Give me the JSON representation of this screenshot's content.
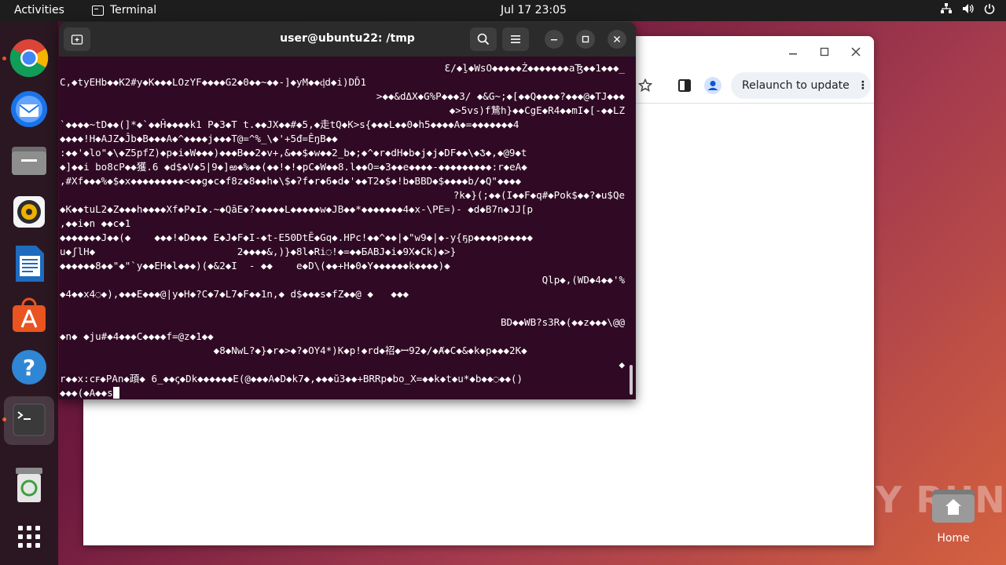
{
  "topbar": {
    "activities": "Activities",
    "app_name": "Terminal",
    "clock": "Jul 17  23:05",
    "tray_icons": [
      "network-icon",
      "volume-icon",
      "power-icon"
    ]
  },
  "dock": {
    "items": [
      "chrome-icon",
      "thunderbird-icon",
      "files-icon",
      "rhythmbox-icon",
      "libreoffice-writer-icon",
      "app-center-icon",
      "help-icon",
      "terminal-icon",
      "trash-icon",
      "show-apps-icon"
    ]
  },
  "browser": {
    "relaunch_label": "Relaunch to update"
  },
  "terminal": {
    "title": "user@ubuntu22: /tmp",
    "lines": [
      {
        "text": "Ɛ/◆ḻ◆WsO◆◆◆◆◆Ż◆◆◆◆◆◆◆",
        "right": "aꜨ◆◆1◆◆◆_"
      },
      {
        "text": "C‚◆tyEHb◆◆K2#y◆K◆◆◆LOzYF◆◆◆◆G2◆0◆◆~◆◆-]◆yM◆◆ᶁd◆i)DĎ1",
        "right": ""
      },
      {
        "text": "",
        "right": ">◆◆&dΔX◆G%P◆◆◆3/ ◆&G~;◆[◆◆Q◆◆◆◆?◆◆◆@◆TJ◆◆◆"
      },
      {
        "text": "",
        "right": "◆>5vs)f鷙h}◆◆CgE◆R4◆◆mI◆[-◆◆LZ"
      },
      {
        "text": "`◆◆◆◆~tD◆◆(]*◆`◆◆Ĥ◆◆◆◆k1 P◆3◆T t.◆◆JX◆◆#◆5,◆走tQ◆K>s{◆◆◆L◆◆0◆h5◆◆◆◆A◆=◆◆◆◆◆◆◆4",
        "right": ""
      },
      {
        "text": "◆◆◆◆!H◆AJZ◆Ĵb◆B◆◆◆A◆^◆◆◆◆j◆◆◆T@=^%_\\◆'+5đ=ÊŋB◆◆",
        "right": ""
      },
      {
        "text": ":◆◆'◆lo\"◆\\◆Z5pfZ)◆p◆i◆W◆◆◆)◆◆◆B◆◆2◆v+,&◆◆$◆w◆◆2_b◆;◆^◆r◆dH◆b◆j◆j◆DF◆◆\\◆Ჯ◆,◆@9◆t",
        "right": ""
      },
      {
        "text": "◆]◆◆i bo8cP◆◆獲.6 ◆d$◆V◆5|9◆]ఱ◆%◆◆(◆◆!◆!◆pC◆W◆◆8.l◆◆O=◆3◆◆e◆◆◆◆-◆◆◆◆◆◆◆◆◆:r◆eA◆",
        "right": ""
      },
      {
        "text": ",#Xf◆◆◆%◆$◆x◆◆◆◆◆◆◆◆◆<◆◆g◆c◆f8z◆8◆◆h◆\\$◆ʔf◆r◆6◆d◆'◆◆T2◆$◆!b◆BBD◆$◆◆◆◆b/◆Q\"◆◆◆◆",
        "right": ""
      },
      {
        "text": "",
        "right": "?k◆}(;◆◆(I◆◆F◆q#◆Pok$◆◆?◆u$Qe"
      },
      {
        "text": "◆K◆◆tuL2◆Z◆◆◆h◆◆◆◆Xf◆P◆I◆.~◆QāE◆?◆◆◆◆◆L◆◆◆◆◆w◆JB◆◆*◆◆◆◆◆◆◆4◆x-\\PE=)- ◆d◆B7n◆JJ[p",
        "right": ""
      },
      {
        "text": ",◆◆i◆n ◆◆c◆1",
        "right": ""
      },
      {
        "text": "◆◆◆◆◆◆◆J◆◆(◆    ◆◆◆!◆D◆◆◆ E◆J◆F◆I-◆t-E50DtĒ◆Gq◆.HPc!◆◆^◆◆|◆\"w9◆|◆-y{ҕp◆◆◆◆p◆◆◆◆◆",
        "right": ""
      },
      {
        "text": "u◆ʃlH◆                        2◆◆◆◆&,)}◆8l◆Ri◌!◆=◆◆БABJ◆i◆9X◆Ck)◆>}",
        "right": ""
      },
      {
        "text": "◆◆◆◆◆◆8◆◆\"◆\"`y◆◆EH◆l◆◆◆)(◆&2◆I  - ◆◆    e◆D\\(◆◆+H◆0◆Y◆◆◆◆◆◆k◆◆◆◆)◆",
        "right": ""
      },
      {
        "text": "",
        "right": "Qlp◆,(WD◆4◆◆'%"
      },
      {
        "text": "◆4◆◆x4◌◆),◆◆◆E◆◆◆@|y◆H◆?C◆7◆L7◆F◆◆1n,◆ d$◆◆◆s◆fZ◆◆@ ◆   ◆◆◆",
        "right": ""
      },
      {
        "text": "",
        "right": ""
      },
      {
        "text": "",
        "right": "BD◆◆WB?s3R◆(◆◆z◆◆◆\\@@"
      },
      {
        "text": "◆n◆ ◆ju#◆4◆◆◆C◆◆◆◆f=@z◆1◆◆",
        "right": ""
      },
      {
        "text": "                          ◆8◆NwL?◆}◆r◆>◆?◆OY4*)K◆p!◆rd◆祒◆ꟷ92◆/◆Ⱥ◆C◆&◆k◆p◆◆◆2K◆",
        "right": ""
      },
      {
        "text": "",
        "right": "◆"
      },
      {
        "text": "r◆◆x:cꜰ◆PAn◆頙◆ 6_◆◆ꞔ◆Dk◆◆◆◆◆◆E(@◆◆◆A◆D◆k7◆,◆◆◆ŭ3◆◆+BRRp◆bo_X=◆◆k◆t◆u*◆b◆◆◌◆◆()",
        "right": ""
      },
      {
        "text": "◆◆◆(◆A◆◆s",
        "right": ""
      }
    ]
  },
  "watermark": "ANY RUN",
  "desktop": {
    "home_label": "Home"
  }
}
